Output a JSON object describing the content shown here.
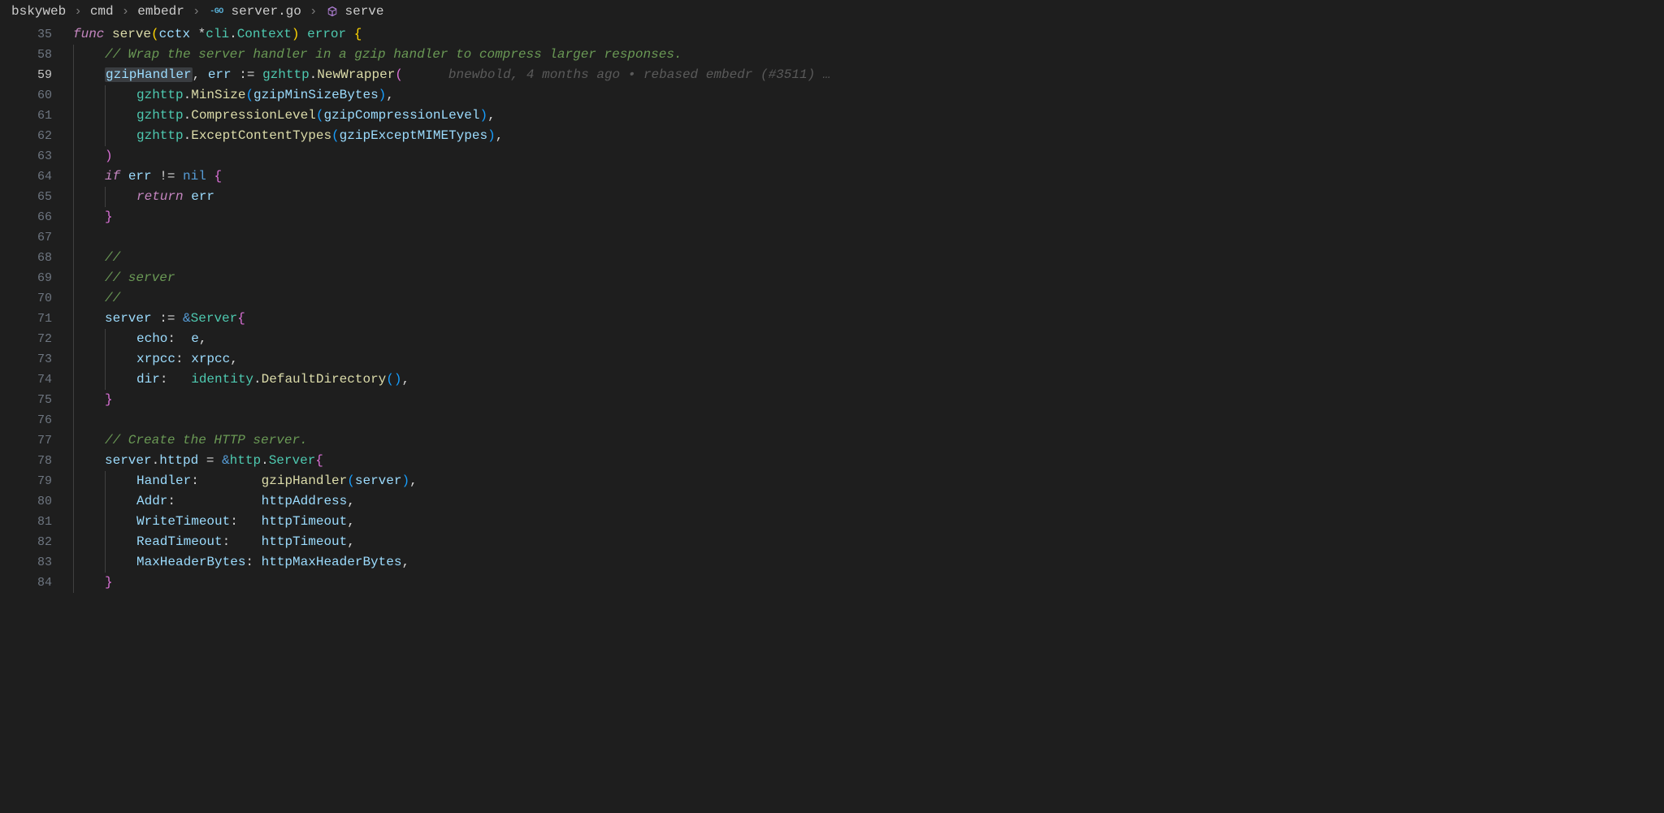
{
  "breadcrumb": {
    "segments": [
      "bskyweb",
      "cmd",
      "embedr",
      "server.go",
      "serve"
    ]
  },
  "blame": {
    "author": "bnewbold",
    "age": "4 months ago",
    "message": "rebased embedr (#3511) …"
  },
  "lines": [
    {
      "n": 35,
      "indent": 0,
      "tokens": [
        {
          "c": "tk-kw",
          "t": "func"
        },
        {
          "c": "tk-plain",
          "t": " "
        },
        {
          "c": "tk-fnname",
          "t": "serve"
        },
        {
          "c": "tk-paren",
          "t": "("
        },
        {
          "c": "tk-param",
          "t": "cctx"
        },
        {
          "c": "tk-plain",
          "t": " "
        },
        {
          "c": "tk-op",
          "t": "*"
        },
        {
          "c": "tk-pkg",
          "t": "cli"
        },
        {
          "c": "tk-plain",
          "t": "."
        },
        {
          "c": "tk-type",
          "t": "Context"
        },
        {
          "c": "tk-paren",
          "t": ")"
        },
        {
          "c": "tk-plain",
          "t": " "
        },
        {
          "c": "tk-type",
          "t": "error"
        },
        {
          "c": "tk-plain",
          "t": " "
        },
        {
          "c": "tk-brace",
          "t": "{"
        }
      ]
    },
    {
      "n": 58,
      "indent": 1,
      "tokens": [
        {
          "c": "tk-comment",
          "t": "// Wrap the server handler in a gzip handler to compress larger responses."
        }
      ]
    },
    {
      "n": 59,
      "indent": 1,
      "current": true,
      "blame": true,
      "tokens": [
        {
          "c": "tk-var",
          "t": "gzipHandler",
          "sel": true
        },
        {
          "c": "tk-plain",
          "t": ", "
        },
        {
          "c": "tk-var",
          "t": "err"
        },
        {
          "c": "tk-plain",
          "t": " "
        },
        {
          "c": "tk-op",
          "t": ":="
        },
        {
          "c": "tk-plain",
          "t": " "
        },
        {
          "c": "tk-pkg",
          "t": "gzhttp"
        },
        {
          "c": "tk-plain",
          "t": "."
        },
        {
          "c": "tk-call",
          "t": "NewWrapper"
        },
        {
          "c": "tk-paren2",
          "t": "("
        }
      ]
    },
    {
      "n": 60,
      "indent": 2,
      "tokens": [
        {
          "c": "tk-pkg",
          "t": "gzhttp"
        },
        {
          "c": "tk-plain",
          "t": "."
        },
        {
          "c": "tk-call",
          "t": "MinSize"
        },
        {
          "c": "tk-paren3",
          "t": "("
        },
        {
          "c": "tk-var",
          "t": "gzipMinSizeBytes"
        },
        {
          "c": "tk-paren3",
          "t": ")"
        },
        {
          "c": "tk-plain",
          "t": ","
        }
      ]
    },
    {
      "n": 61,
      "indent": 2,
      "tokens": [
        {
          "c": "tk-pkg",
          "t": "gzhttp"
        },
        {
          "c": "tk-plain",
          "t": "."
        },
        {
          "c": "tk-call",
          "t": "CompressionLevel"
        },
        {
          "c": "tk-paren3",
          "t": "("
        },
        {
          "c": "tk-var",
          "t": "gzipCompressionLevel"
        },
        {
          "c": "tk-paren3",
          "t": ")"
        },
        {
          "c": "tk-plain",
          "t": ","
        }
      ]
    },
    {
      "n": 62,
      "indent": 2,
      "tokens": [
        {
          "c": "tk-pkg",
          "t": "gzhttp"
        },
        {
          "c": "tk-plain",
          "t": "."
        },
        {
          "c": "tk-call",
          "t": "ExceptContentTypes"
        },
        {
          "c": "tk-paren3",
          "t": "("
        },
        {
          "c": "tk-var",
          "t": "gzipExceptMIMETypes"
        },
        {
          "c": "tk-paren3",
          "t": ")"
        },
        {
          "c": "tk-plain",
          "t": ","
        }
      ]
    },
    {
      "n": 63,
      "indent": 1,
      "tokens": [
        {
          "c": "tk-paren2",
          "t": ")"
        }
      ]
    },
    {
      "n": 64,
      "indent": 1,
      "tokens": [
        {
          "c": "tk-kw",
          "t": "if"
        },
        {
          "c": "tk-plain",
          "t": " "
        },
        {
          "c": "tk-var",
          "t": "err"
        },
        {
          "c": "tk-plain",
          "t": " "
        },
        {
          "c": "tk-op",
          "t": "!="
        },
        {
          "c": "tk-plain",
          "t": " "
        },
        {
          "c": "tk-nil",
          "t": "nil"
        },
        {
          "c": "tk-plain",
          "t": " "
        },
        {
          "c": "tk-paren2",
          "t": "{"
        }
      ]
    },
    {
      "n": 65,
      "indent": 2,
      "tokens": [
        {
          "c": "tk-kw",
          "t": "return"
        },
        {
          "c": "tk-plain",
          "t": " "
        },
        {
          "c": "tk-var",
          "t": "err"
        }
      ]
    },
    {
      "n": 66,
      "indent": 1,
      "tokens": [
        {
          "c": "tk-paren2",
          "t": "}"
        }
      ]
    },
    {
      "n": 67,
      "indent": 1,
      "tokens": []
    },
    {
      "n": 68,
      "indent": 1,
      "tokens": [
        {
          "c": "tk-comment",
          "t": "//"
        }
      ]
    },
    {
      "n": 69,
      "indent": 1,
      "tokens": [
        {
          "c": "tk-comment",
          "t": "// server"
        }
      ]
    },
    {
      "n": 70,
      "indent": 1,
      "tokens": [
        {
          "c": "tk-comment",
          "t": "//"
        }
      ]
    },
    {
      "n": 71,
      "indent": 1,
      "tokens": [
        {
          "c": "tk-var",
          "t": "server"
        },
        {
          "c": "tk-plain",
          "t": " "
        },
        {
          "c": "tk-op",
          "t": ":="
        },
        {
          "c": "tk-plain",
          "t": " "
        },
        {
          "c": "tk-amp",
          "t": "&"
        },
        {
          "c": "tk-type",
          "t": "Server"
        },
        {
          "c": "tk-paren2",
          "t": "{"
        }
      ]
    },
    {
      "n": 72,
      "indent": 2,
      "tokens": [
        {
          "c": "tk-field",
          "t": "echo"
        },
        {
          "c": "tk-plain",
          "t": ":  "
        },
        {
          "c": "tk-var",
          "t": "e"
        },
        {
          "c": "tk-plain",
          "t": ","
        }
      ]
    },
    {
      "n": 73,
      "indent": 2,
      "tokens": [
        {
          "c": "tk-field",
          "t": "xrpcc"
        },
        {
          "c": "tk-plain",
          "t": ": "
        },
        {
          "c": "tk-var",
          "t": "xrpcc"
        },
        {
          "c": "tk-plain",
          "t": ","
        }
      ]
    },
    {
      "n": 74,
      "indent": 2,
      "tokens": [
        {
          "c": "tk-field",
          "t": "dir"
        },
        {
          "c": "tk-plain",
          "t": ":   "
        },
        {
          "c": "tk-pkg",
          "t": "identity"
        },
        {
          "c": "tk-plain",
          "t": "."
        },
        {
          "c": "tk-call",
          "t": "DefaultDirectory"
        },
        {
          "c": "tk-paren3",
          "t": "()"
        },
        {
          "c": "tk-plain",
          "t": ","
        }
      ]
    },
    {
      "n": 75,
      "indent": 1,
      "tokens": [
        {
          "c": "tk-paren2",
          "t": "}"
        }
      ]
    },
    {
      "n": 76,
      "indent": 1,
      "tokens": []
    },
    {
      "n": 77,
      "indent": 1,
      "tokens": [
        {
          "c": "tk-comment",
          "t": "// Create the HTTP server."
        }
      ]
    },
    {
      "n": 78,
      "indent": 1,
      "tokens": [
        {
          "c": "tk-var",
          "t": "server"
        },
        {
          "c": "tk-plain",
          "t": "."
        },
        {
          "c": "tk-var",
          "t": "httpd"
        },
        {
          "c": "tk-plain",
          "t": " "
        },
        {
          "c": "tk-op",
          "t": "="
        },
        {
          "c": "tk-plain",
          "t": " "
        },
        {
          "c": "tk-amp",
          "t": "&"
        },
        {
          "c": "tk-pkg",
          "t": "http"
        },
        {
          "c": "tk-plain",
          "t": "."
        },
        {
          "c": "tk-type",
          "t": "Server"
        },
        {
          "c": "tk-paren2",
          "t": "{"
        }
      ]
    },
    {
      "n": 79,
      "indent": 2,
      "tokens": [
        {
          "c": "tk-field",
          "t": "Handler"
        },
        {
          "c": "tk-plain",
          "t": ":        "
        },
        {
          "c": "tk-call",
          "t": "gzipHandler"
        },
        {
          "c": "tk-paren3",
          "t": "("
        },
        {
          "c": "tk-var",
          "t": "server"
        },
        {
          "c": "tk-paren3",
          "t": ")"
        },
        {
          "c": "tk-plain",
          "t": ","
        }
      ]
    },
    {
      "n": 80,
      "indent": 2,
      "tokens": [
        {
          "c": "tk-field",
          "t": "Addr"
        },
        {
          "c": "tk-plain",
          "t": ":           "
        },
        {
          "c": "tk-var",
          "t": "httpAddress"
        },
        {
          "c": "tk-plain",
          "t": ","
        }
      ]
    },
    {
      "n": 81,
      "indent": 2,
      "tokens": [
        {
          "c": "tk-field",
          "t": "WriteTimeout"
        },
        {
          "c": "tk-plain",
          "t": ":   "
        },
        {
          "c": "tk-var",
          "t": "httpTimeout"
        },
        {
          "c": "tk-plain",
          "t": ","
        }
      ]
    },
    {
      "n": 82,
      "indent": 2,
      "tokens": [
        {
          "c": "tk-field",
          "t": "ReadTimeout"
        },
        {
          "c": "tk-plain",
          "t": ":    "
        },
        {
          "c": "tk-var",
          "t": "httpTimeout"
        },
        {
          "c": "tk-plain",
          "t": ","
        }
      ]
    },
    {
      "n": 83,
      "indent": 2,
      "tokens": [
        {
          "c": "tk-field",
          "t": "MaxHeaderBytes"
        },
        {
          "c": "tk-plain",
          "t": ": "
        },
        {
          "c": "tk-var",
          "t": "httpMaxHeaderBytes"
        },
        {
          "c": "tk-plain",
          "t": ","
        }
      ]
    },
    {
      "n": 84,
      "indent": 1,
      "tokens": [
        {
          "c": "tk-paren2",
          "t": "}"
        }
      ]
    }
  ]
}
